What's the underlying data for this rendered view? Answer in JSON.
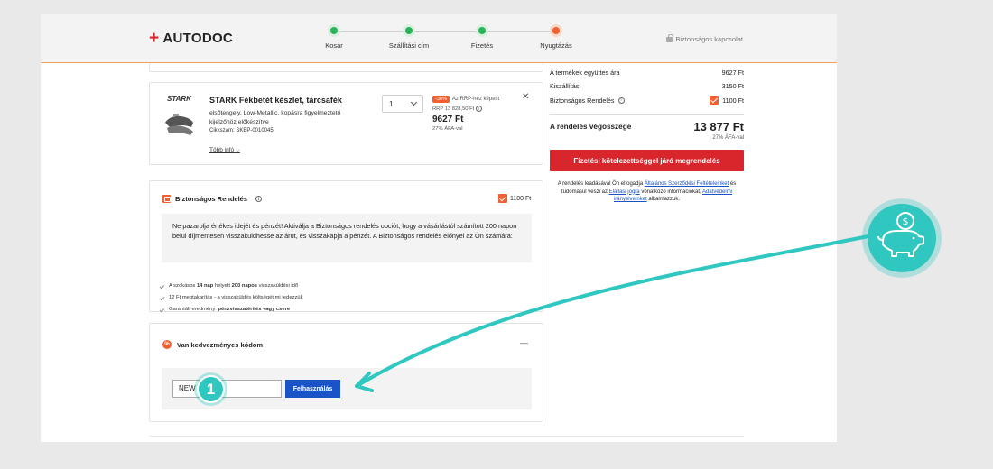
{
  "header": {
    "brand": "AUTODOC",
    "steps": [
      {
        "label": "Kosár",
        "status": "done"
      },
      {
        "label": "Szállítási cím",
        "status": "done"
      },
      {
        "label": "Fizetés",
        "status": "done"
      },
      {
        "label": "Nyugtázás",
        "status": "current"
      }
    ],
    "secure_label": "Biztonságos kapcsolat"
  },
  "product": {
    "brand_logo": "STARK",
    "name": "STARK Fékbetét készlet, tárcsafék",
    "description": "elsőtengely, Low-Metallic, kopásra figyelmeztető kijelzőhöz előkészítve",
    "sku": "Cikkszám: SKBP-0010045",
    "more_info": "Több infó",
    "quantity": "1",
    "discount_badge": "-30%",
    "discount_text": "Az RRP-hez képest",
    "rrp": "RRP 13 828,50 Ft",
    "price": "9627 Ft",
    "vat": "27% ÁFA-val"
  },
  "safe_order": {
    "title": "Biztonságos Rendelés",
    "fee": "1100 Ft",
    "description": "Ne pazarolja értékes idejét és pénzét! Aktiválja a Biztonságos rendelés opciót, hogy a vásárlástól számított 200 napon belül díjmentesen visszaküldhesse az árut, és visszakapja a pénzét. A Biztonságos rendelés előnyei az Ön számára:",
    "benefits": [
      [
        "A szokásos ",
        "14 nap",
        " helyett ",
        "200 napos",
        " visszaküldési idő"
      ],
      [
        "12 Ft megtakarítás - a visszaküldés költségét mi fedezzük",
        "",
        "",
        "",
        ""
      ],
      [
        "Garantált eredmény: ",
        "pénzvisszatérítés vagy csere",
        "",
        "",
        ""
      ]
    ]
  },
  "coupon": {
    "title": "Van kedvezményes kódom",
    "collapse_symbol": "—",
    "input_value": "NEW",
    "apply_label": "Felhasználás"
  },
  "summary": {
    "rows": [
      {
        "label": "A termékek együttes ára",
        "value": "9627 Ft"
      },
      {
        "label": "Kiszállítás",
        "value": "3150 Ft"
      },
      {
        "label": "Biztonságos Rendelés",
        "value": "1100 Ft"
      }
    ],
    "total_label": "A rendelés végösszege",
    "total_value": "13 877 Ft",
    "total_vat": "27% ÁFA-val",
    "order_button": "Fizetési kötelezettséggel járó megrendelés",
    "terms": {
      "p1": "A rendelés leadásával Ön elfogadja ",
      "link1": "Általános Szerződési Feltételeinket",
      "p2": " és tudomásul veszi az ",
      "link2": "Elállási jogra",
      "p3": " vonatkozó információkat, ",
      "link3": "Adatvédelmi irányelveinket",
      "p4": " alkalmazzuk."
    }
  },
  "annotation": {
    "step_number": "1",
    "badge_icon": "piggy-bank-coin-icon",
    "accent_color": "#2fc7c0"
  },
  "colors": {
    "brand_red": "#d9262c",
    "orange": "#f06030",
    "button_blue": "#1a53c8",
    "step_green": "#2bb35a"
  }
}
